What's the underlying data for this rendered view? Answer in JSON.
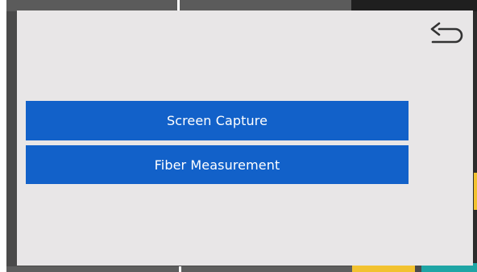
{
  "modal": {
    "back_icon": "return-arrow-icon",
    "buttons": [
      {
        "label": "Screen Capture"
      },
      {
        "label": "Fiber Measurement"
      }
    ]
  },
  "colors": {
    "modal_background": "#e8e6e7",
    "button_background": "#1261c9",
    "button_text": "#ffffff",
    "icon_color": "#333333"
  }
}
